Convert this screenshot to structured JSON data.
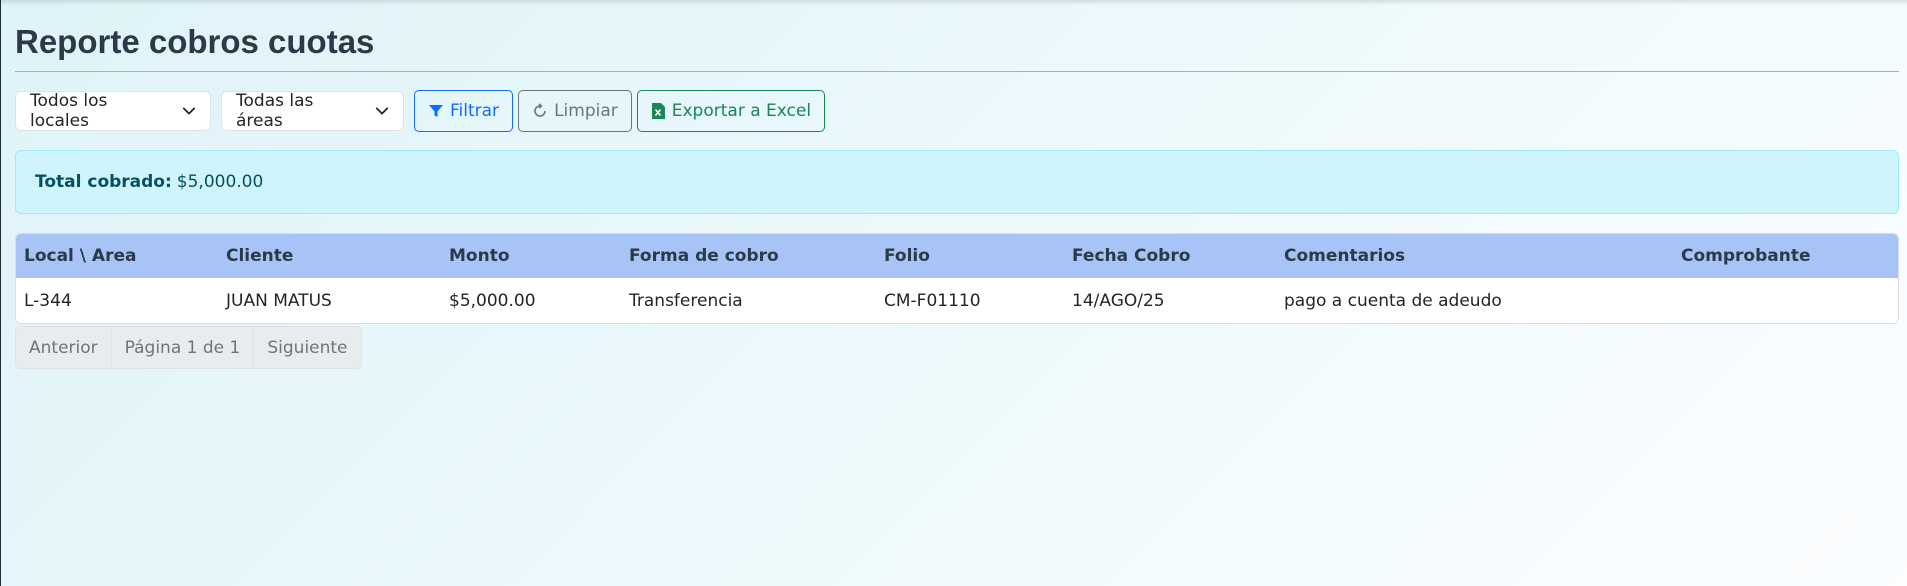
{
  "page": {
    "title": "Reporte cobros cuotas"
  },
  "filters": {
    "locales_select": "Todos los locales",
    "areas_select": "Todas las áreas",
    "filter_button": "Filtrar",
    "clear_button": "Limpiar",
    "export_button": "Exportar a Excel"
  },
  "summary": {
    "total_label": "Total cobrado:",
    "total_value": "$5,000.00"
  },
  "table": {
    "headers": [
      "Local \\ Area",
      "Cliente",
      "Monto",
      "Forma de cobro",
      "Folio",
      "Fecha Cobro",
      "Comentarios",
      "Comprobante"
    ],
    "rows": [
      [
        "L-344",
        "JUAN MATUS",
        "$5,000.00",
        "Transferencia",
        "CM-F01110",
        "14/AGO/25",
        "pago a cuenta de adeudo",
        ""
      ]
    ]
  },
  "pagination": {
    "prev": "Anterior",
    "current": "Página 1 de 1",
    "next": "Siguiente"
  },
  "colors": {
    "primary": "#0d6efd",
    "secondary": "#6c757d",
    "success": "#198754",
    "info_bg": "#cff4fc",
    "table_header_bg": "#a8c4f7"
  },
  "icons": {
    "select_chevron": "chevron-down-icon",
    "filter": "funnel-icon",
    "clear": "refresh-icon",
    "export": "excel-file-icon"
  }
}
